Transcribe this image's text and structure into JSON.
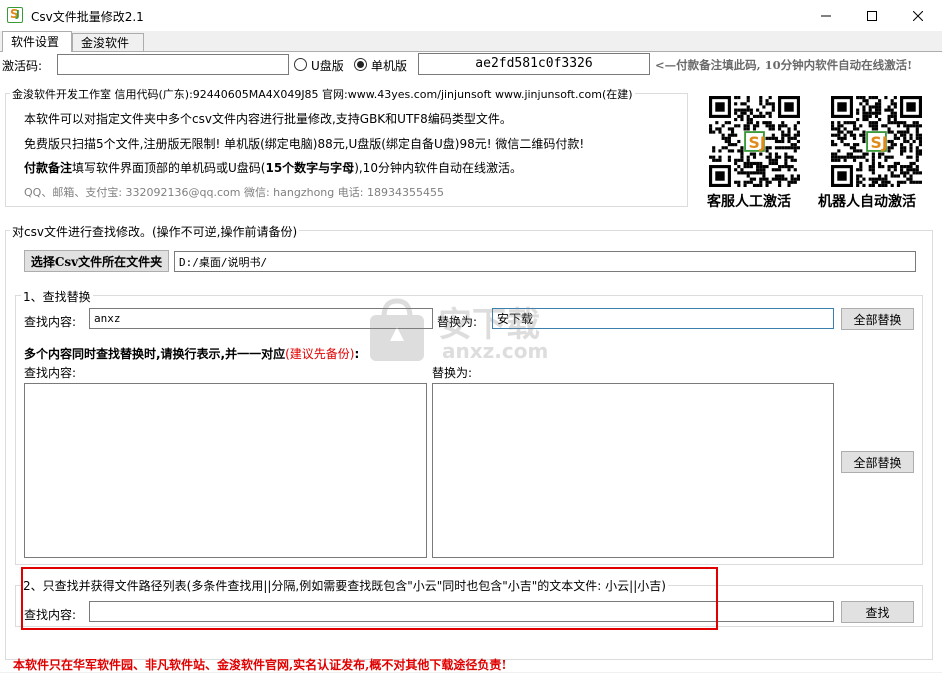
{
  "window": {
    "title": "Csv文件批量修改2.1"
  },
  "tabs": [
    {
      "label": "软件设置"
    },
    {
      "label": "金浚软件"
    }
  ],
  "activation": {
    "code_label": "激活码:",
    "code_value": "",
    "radio_udisk": "U盘版",
    "radio_machine": "单机版",
    "machine_code": "ae2fd581c0f3326",
    "hint": "<—付款备注填此码, 10分钟内软件自动在线激活!"
  },
  "info": {
    "group_label": "金浚软件开发工作室 信用代码(广东):92440605MA4X049J85 官网:www.43yes.com/jinjunsoft  www.jinjunsoft.com(在建)",
    "line1": "本软件可以对指定文件夹中多个csv文件内容进行批量修改,支持GBK和UTF8编码类型文件。",
    "line2": "免费版只扫描5个文件,注册版无限制! 单机版(绑定电脑)88元,U盘版(绑定自备U盘)98元! 微信二维码付款!",
    "line3_bold": "付款备注",
    "line3_a": "填写软件界面顶部的单机码或U盘码(",
    "line3_bold2": "15个数字与字母",
    "line3_b": "),10分钟内软件自动在线激活。",
    "line4": "QQ、邮箱、支付宝: 332092136@qq.com    微信: hangzhong    电话: 18934355455",
    "qr1_label": "客服人工激活",
    "qr2_label": "机器人自动激活"
  },
  "main": {
    "group_label": "对csv文件进行查找修改。(操作不可逆,操作前请备份)",
    "select_folder_button": "选择Csv文件所在文件夹",
    "folder_path": "D:/桌面/说明书/",
    "section1": {
      "label": "1、查找替换",
      "find_label": "查找内容:",
      "find_value": "anxz",
      "replace_label": "替换为:",
      "replace_value": "安下载",
      "replace_all_button": "全部替换",
      "multi_note_a": "多个内容同时查找替换时,请换行表示,并一一对应",
      "multi_note_red": "(建议先备份)",
      "multi_note_b": ":",
      "multi_find_label": "查找内容:",
      "multi_replace_label": "替换为:",
      "multi_replace_all_button": "全部替换"
    },
    "section2": {
      "label": "2、只查找并获得文件路径列表(多条件查找用||分隔,例如需要查找既包含\"小云\"同时也包含\"小吉\"的文本文件: 小云||小吉)",
      "find_label": "查找内容:",
      "find_value": "",
      "find_button": "查找"
    }
  },
  "footer": {
    "notice": "本软件只在华军软件园、非凡软件站、金浚软件官网,实名认证发布,概不对其他下载途径负责!"
  },
  "watermark": {
    "text": "安下载",
    "subtext": "anxz.com"
  },
  "colors": {
    "hint_red": "#6a6a6a",
    "warn_red": "#e00000",
    "highlight_box": "#e00000"
  }
}
